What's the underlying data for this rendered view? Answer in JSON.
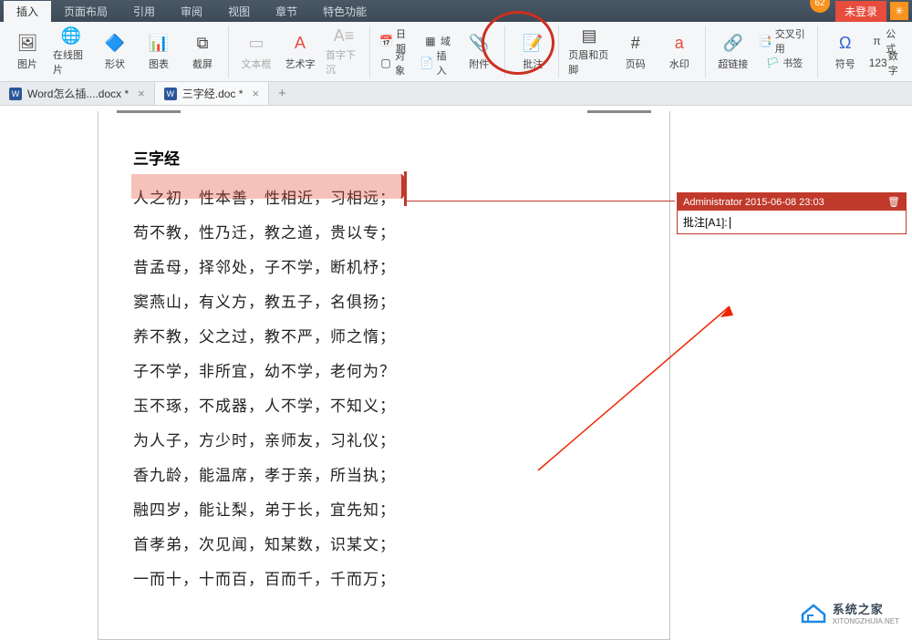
{
  "menubar": {
    "tabs": [
      "插入",
      "页面布局",
      "引用",
      "审阅",
      "视图",
      "章节",
      "特色功能"
    ],
    "active_index": 0,
    "badge": "62",
    "login": "未登录"
  },
  "ribbon": {
    "g1": {
      "pic": "图片",
      "online": "在线图片",
      "shape": "形状",
      "chart": "图表",
      "screenshot": "截屏"
    },
    "g2": {
      "textbox": "文本框",
      "wordart": "艺术字",
      "dropcap": "首字下沉"
    },
    "g3": {
      "date": "日期",
      "field": "域",
      "object": "对象",
      "insert": "插入",
      "attach": "附件"
    },
    "g4": {
      "comment": "批注"
    },
    "g5": {
      "header": "页眉和页脚",
      "pagenum": "页码",
      "watermark": "水印"
    },
    "g6": {
      "link": "超链接",
      "xref": "交叉引用",
      "bookmark": "书签"
    },
    "g7": {
      "symbol": "符号",
      "formula": "公式",
      "number": "数字"
    }
  },
  "doctabs": {
    "tabs": [
      {
        "name": "Word怎么插....docx *"
      },
      {
        "name": "三字经.doc *"
      }
    ],
    "active": 1
  },
  "document": {
    "title": "三字经",
    "lines": [
      "人之初，性本善，性相近，习相远；",
      "苟不教，性乃迁，教之道，贵以专；",
      "昔孟母，择邻处，子不学，断机杼；",
      "窦燕山，有义方，教五子，名俱扬；",
      "养不教，父之过，教不严，师之惰；",
      "子不学，非所宜，幼不学，老何为？",
      "玉不琢，不成器，人不学，不知义；",
      "为人子，方少时，亲师友，习礼仪；",
      "香九龄，能温席，孝于亲，所当执；",
      "融四岁，能让梨，弟于长，宜先知；",
      "首孝弟，次见闻，知某数，识某文；",
      "一而十，十而百，百而千，千而万；"
    ]
  },
  "comment": {
    "author": "Administrator",
    "timestamp": "2015-06-08 23:03",
    "label": "批注[A1]:"
  },
  "watermark": {
    "name": "系统之家",
    "url": "XITONGZHIJIA.NET"
  }
}
